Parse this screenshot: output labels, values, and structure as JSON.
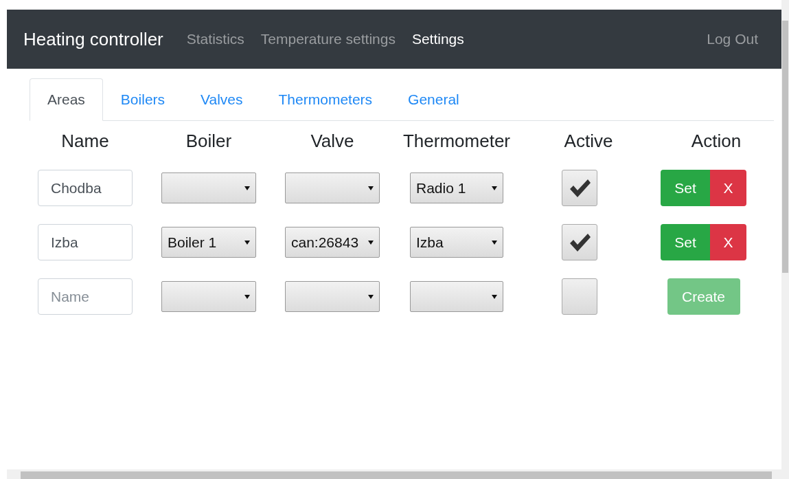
{
  "navbar": {
    "brand": "Heating controller",
    "links": [
      {
        "label": "Statistics",
        "selected": false
      },
      {
        "label": "Temperature settings",
        "selected": false
      },
      {
        "label": "Settings",
        "selected": true
      }
    ],
    "logout": "Log Out"
  },
  "tabs": [
    {
      "label": "Areas",
      "selected": true
    },
    {
      "label": "Boilers",
      "selected": false
    },
    {
      "label": "Valves",
      "selected": false
    },
    {
      "label": "Thermometers",
      "selected": false
    },
    {
      "label": "General",
      "selected": false
    }
  ],
  "columns": [
    "Name",
    "Boiler",
    "Valve",
    "Thermometer",
    "Active",
    "Action"
  ],
  "rows": [
    {
      "kind": "area",
      "name": "Chodba",
      "thermometer": "Radio 1",
      "active": true,
      "actions": [
        "Set",
        "X"
      ]
    },
    {
      "kind": "area",
      "name": "Izba",
      "boiler": "Boiler 1",
      "valve": "can:26843",
      "thermometer": "Izba",
      "active": true,
      "actions": [
        "Set",
        "X"
      ]
    },
    {
      "kind": "new",
      "placeholder": "Name",
      "active": false,
      "create": {
        "label": "Create",
        "disabled": true
      }
    }
  ]
}
